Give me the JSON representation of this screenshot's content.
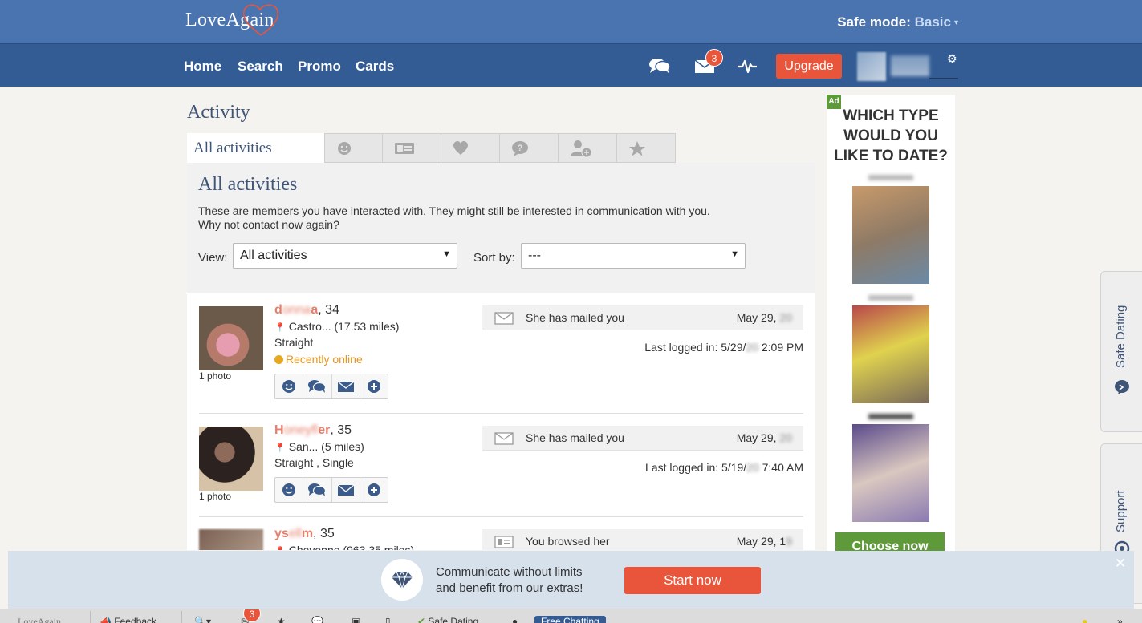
{
  "brand": {
    "logo": "LoveAgain"
  },
  "header": {
    "safe_mode_label": "Safe mode:",
    "safe_mode_value": "Basic"
  },
  "nav": {
    "links": [
      "Home",
      "Search",
      "Promo",
      "Cards"
    ],
    "mail_badge": "3",
    "upgrade": "Upgrade"
  },
  "page": {
    "title": "Activity"
  },
  "tabs": {
    "active": "All activities"
  },
  "panel": {
    "heading": "All activities",
    "desc_1": "These are members you have interacted with. They might still be interested in communication with you.",
    "desc_2": "Why not contact now again?",
    "view_label": "View:",
    "view_value": "All activities",
    "sort_label": "Sort by:",
    "sort_value": "---"
  },
  "members": [
    {
      "name_a": "d",
      "name_blur": "onna",
      "name_b": "a",
      "age": ", 34",
      "location": "Castro... (17.53 miles)",
      "meta": "Straight",
      "status": "Recently online",
      "photo_count": "1 photo",
      "activity": "She has mailed you",
      "date": "May 29,",
      "last_login_label": "Last logged in: 5/29/",
      "last_login_time": " 2:09 PM"
    },
    {
      "name_a": "H",
      "name_blur": "oneyfl",
      "name_b": "er",
      "age": ", 35",
      "location": "San... (5 miles)",
      "meta": "Straight , Single",
      "photo_count": "1 photo",
      "activity": "She has mailed you",
      "date": "May 29,",
      "last_login_label": "Last logged in: 5/19/",
      "last_login_time": " 7:40 AM"
    },
    {
      "name_a": "ys",
      "name_blur": "ell",
      "name_b": "m",
      "age": ", 35",
      "location": "Cheyenne (963.35 miles)",
      "activity": "You browsed her",
      "date": "May 29, 1"
    }
  ],
  "ad": {
    "tag": "Ad",
    "title": "WHICH TYPE WOULD YOU LIKE TO DATE?",
    "button": "Choose now"
  },
  "side_tabs": {
    "safe_dating": "Safe Dating",
    "support": "Support"
  },
  "promo": {
    "line1": "Communicate without limits",
    "line2": "and benefit from our extras!",
    "button": "Start now"
  },
  "taskbar": {
    "logo": "LoveAgain",
    "feedback": "Feedback",
    "badge": "3",
    "safe_dating": "Safe Dating",
    "free_chatting": "Free Chatting"
  },
  "colors": {
    "header": "#4a74b0",
    "nav": "#335c94",
    "accent": "#e8553a",
    "ad_green": "#5f9a3a"
  }
}
